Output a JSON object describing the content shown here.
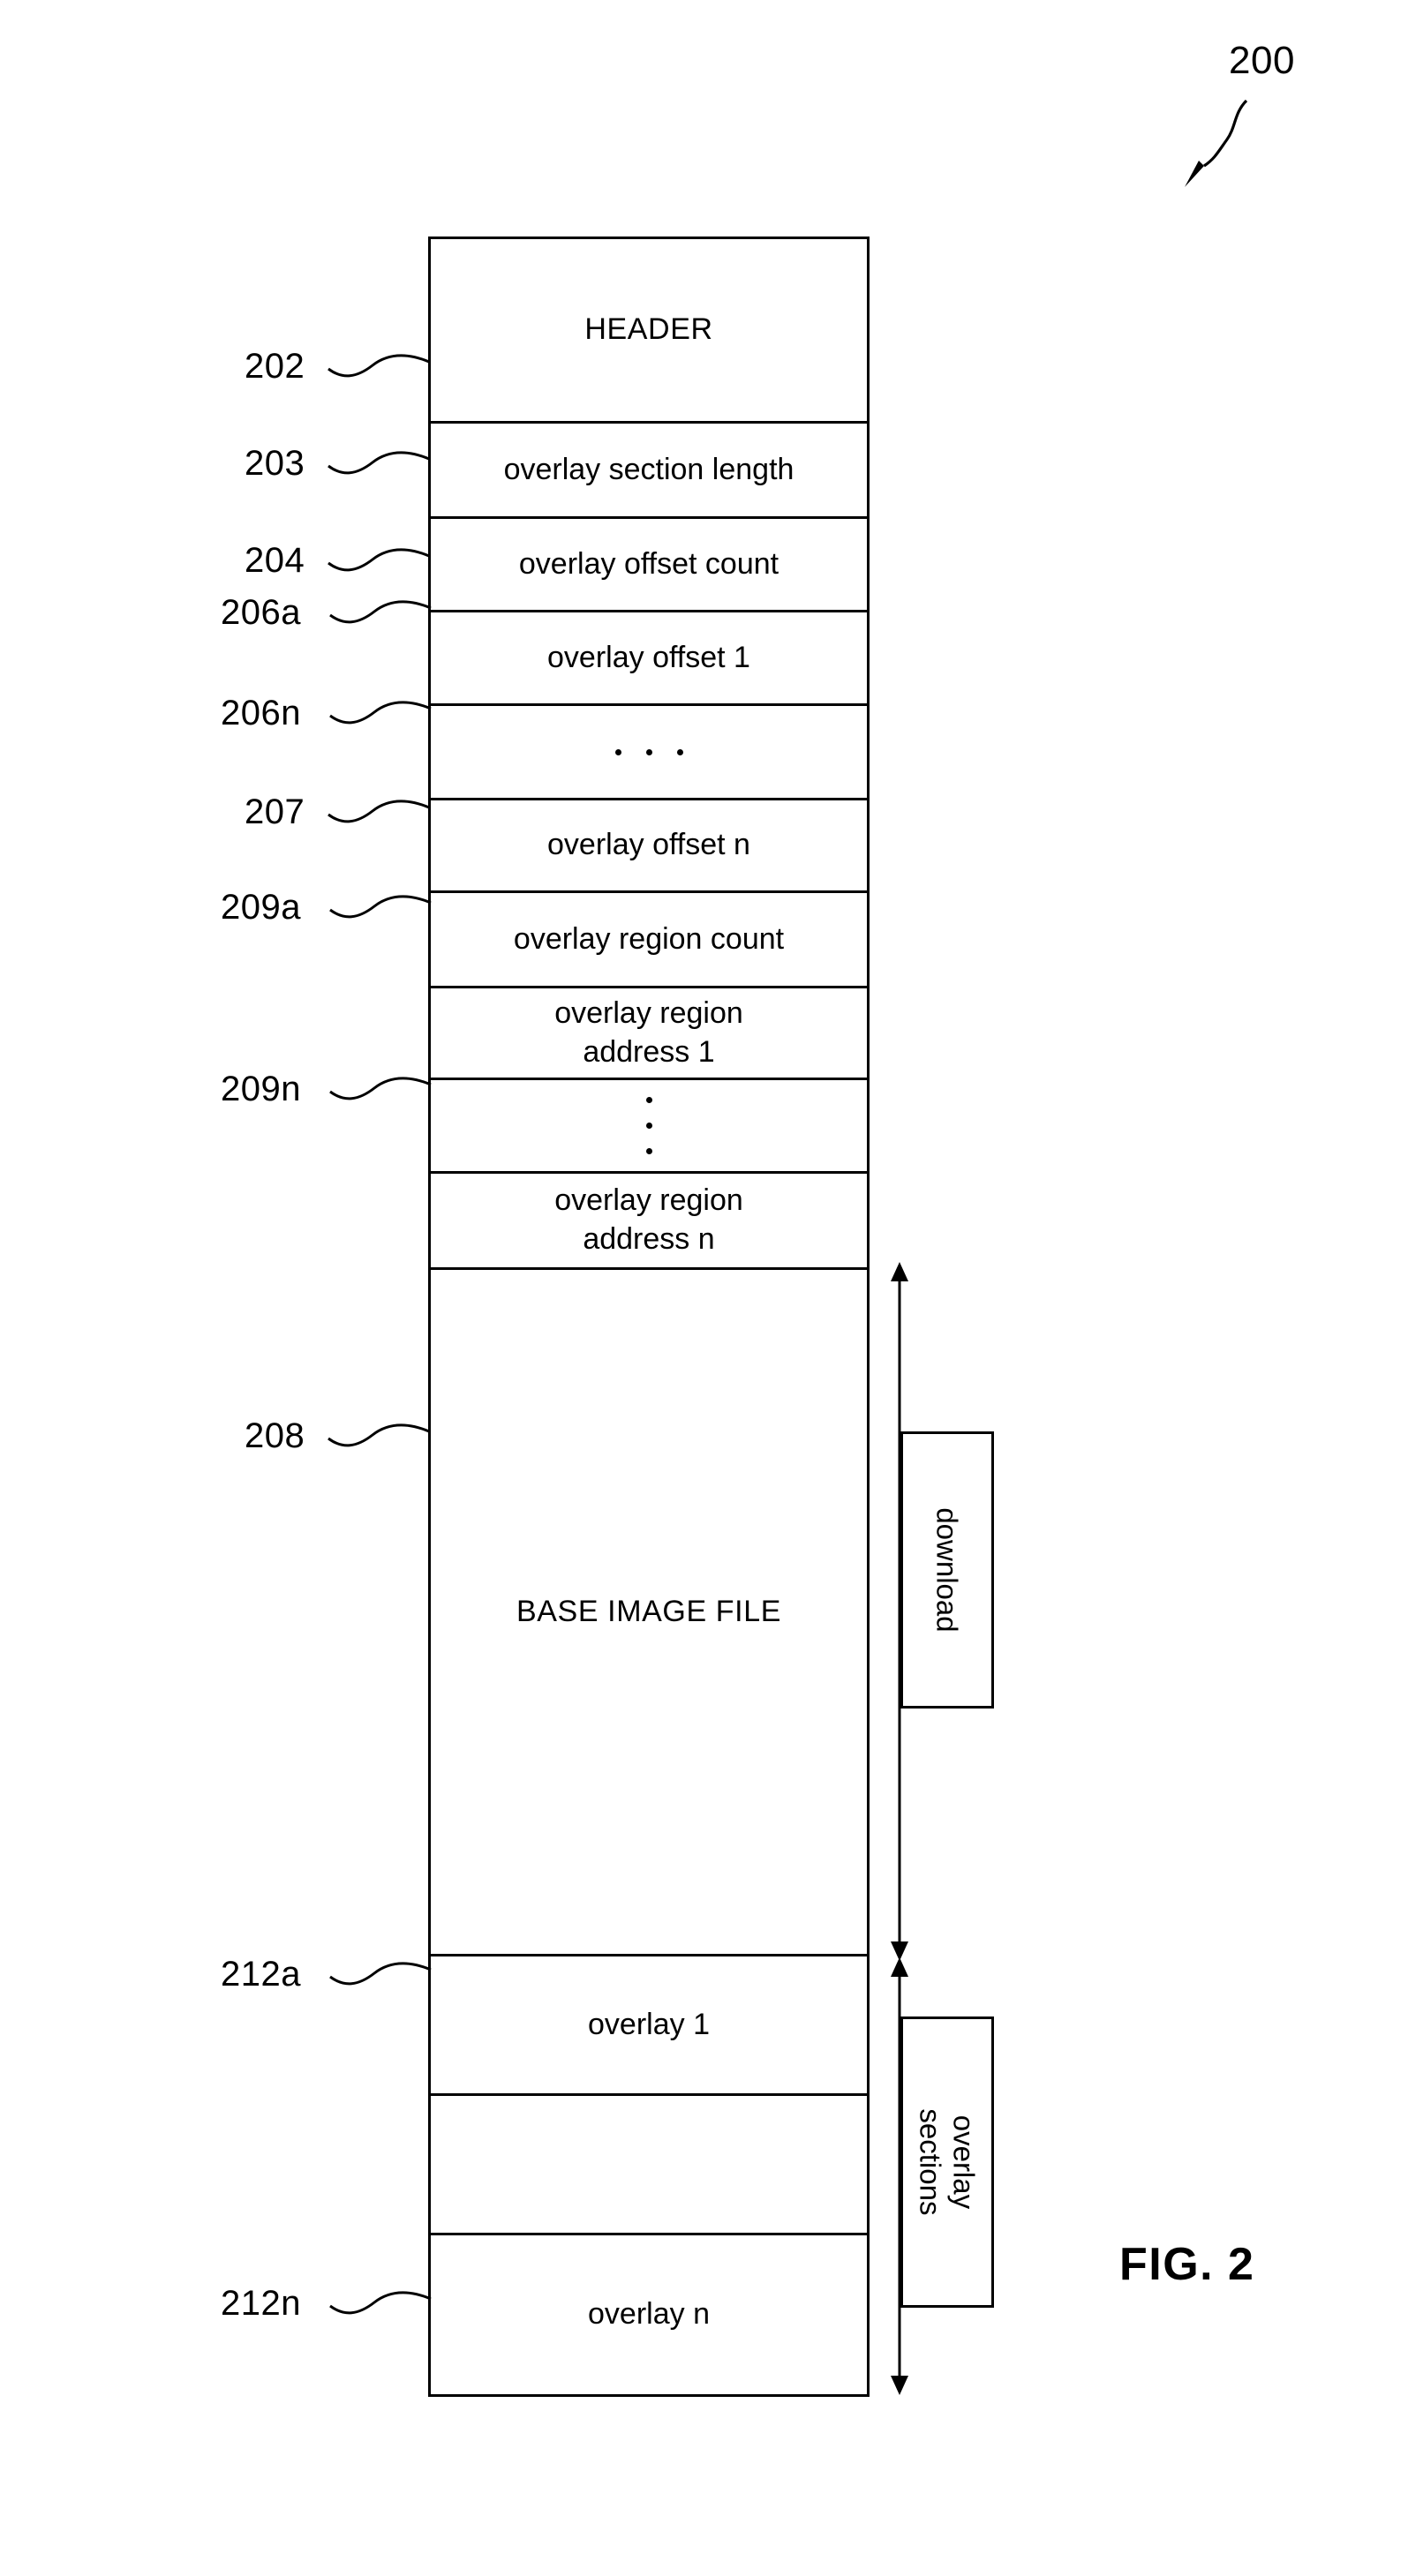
{
  "figure": {
    "number_ref": "200",
    "caption": "FIG. 2"
  },
  "diagram": {
    "rows": [
      {
        "ref": "202",
        "label": "HEADER"
      },
      {
        "ref": "203",
        "label": "overlay section length"
      },
      {
        "ref": "204",
        "label": "overlay offset count"
      },
      {
        "ref": "206a",
        "label": "overlay offset 1"
      },
      {
        "ref": "",
        "label": "• • •"
      },
      {
        "ref": "206n",
        "label": "overlay offset n"
      },
      {
        "ref": "207",
        "label": "overlay region count"
      },
      {
        "ref": "209a",
        "label": "overlay region address 1"
      },
      {
        "ref": "",
        "label": "⋮"
      },
      {
        "ref": "209n",
        "label": "overlay region address n"
      },
      {
        "ref": "208",
        "label": "BASE IMAGE FILE"
      },
      {
        "ref": "212a",
        "label": "overlay 1"
      },
      {
        "ref": "",
        "label": ""
      },
      {
        "ref": "212n",
        "label": "overlay n"
      }
    ],
    "row_labels": {
      "header": "HEADER",
      "overlay_section_length": "overlay section length",
      "overlay_offset_count": "overlay offset count",
      "overlay_offset_1": "overlay offset 1",
      "overlay_offset_n": "overlay offset n",
      "overlay_region_count": "overlay region count",
      "overlay_region_address_1_line1": "overlay region",
      "overlay_region_address_1_line2": "address 1",
      "overlay_region_address_n_line1": "overlay region",
      "overlay_region_address_n_line2": "address n",
      "base_image_file": "BASE IMAGE FILE",
      "overlay_1": "overlay 1",
      "overlay_blank": "",
      "overlay_n": "overlay n"
    },
    "refs": {
      "r202": "202",
      "r203": "203",
      "r204": "204",
      "r206a": "206a",
      "r206n": "206n",
      "r207": "207",
      "r209a": "209a",
      "r209n": "209n",
      "r208": "208",
      "r212a": "212a",
      "r212n": "212n"
    },
    "brackets": {
      "download": "download",
      "overlay_sections_line1": "overlay",
      "overlay_sections_line2": "sections"
    }
  },
  "colors": {
    "ink": "#000000",
    "paper": "#ffffff"
  }
}
